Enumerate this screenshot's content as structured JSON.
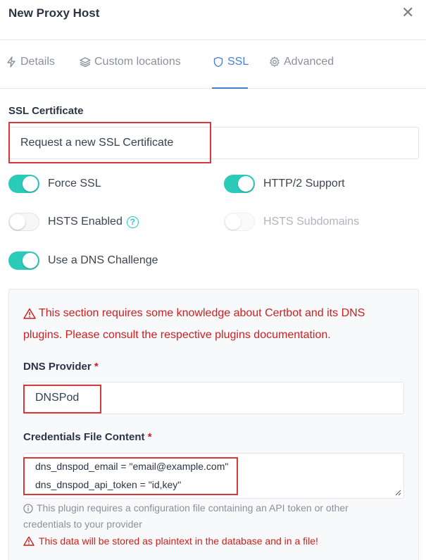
{
  "modal": {
    "title": "New Proxy Host",
    "close_icon": "close-icon"
  },
  "tabs": [
    {
      "label": "Details",
      "icon": "bolt-icon",
      "active": false
    },
    {
      "label": "Custom locations",
      "icon": "layers-icon",
      "active": false
    },
    {
      "label": "SSL",
      "icon": "shield-icon",
      "active": true
    },
    {
      "label": "Advanced",
      "icon": "gear-icon",
      "active": false
    }
  ],
  "ssl": {
    "certificate_label": "SSL Certificate",
    "certificate_value": "Request a new SSL Certificate",
    "toggles": {
      "force_ssl": {
        "label": "Force SSL",
        "on": true
      },
      "http2": {
        "label": "HTTP/2 Support",
        "on": true
      },
      "hsts": {
        "label": "HSTS Enabled",
        "on": false
      },
      "hsts_sub": {
        "label": "HSTS Subdomains",
        "on": false,
        "disabled": true
      },
      "dns_challenge": {
        "label": "Use a DNS Challenge",
        "on": true
      }
    },
    "hsts_help_glyph": "?"
  },
  "dns": {
    "warning_line1": "This section requires some knowledge about Certbot and its DNS",
    "warning_line2": "plugins. Please consult the respective plugins documentation.",
    "provider_label": "DNS Provider",
    "required_mark": "*",
    "provider_value": "DNSPod",
    "credentials_label": "Credentials File Content",
    "credentials_lines": [
      "dns_dnspod_email = \"email@example.com\"",
      "dns_dnspod_api_token = \"id,key\""
    ],
    "info_line1": "This plugin requires a configuration file containing an API token or other",
    "info_line2": "credentials to your provider",
    "plaintext_warning": "This data will be stored as plaintext in the database and in a file!"
  },
  "colors": {
    "accent": "#467fcf",
    "toggle_on": "#2bcbba",
    "danger": "#cd201f",
    "highlight_box": "#d9383a"
  }
}
